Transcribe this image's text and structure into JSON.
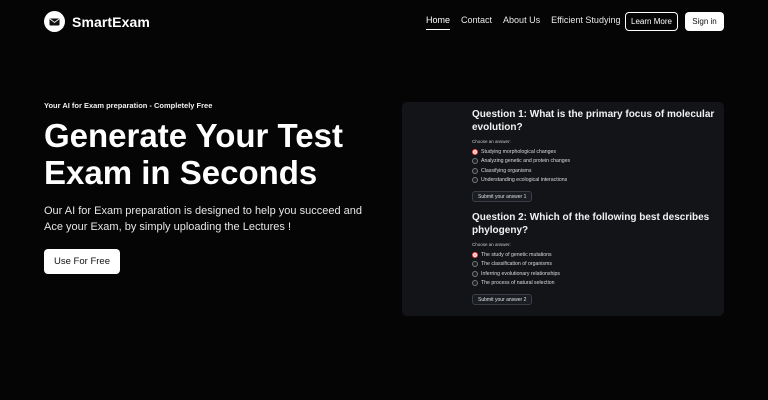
{
  "header": {
    "logo_text": "SmartExam",
    "nav": [
      "Home",
      "Contact",
      "About Us",
      "Efficient Studying"
    ],
    "active_nav": "Home",
    "learn_more": "Learn More",
    "sign_in": "Sign in"
  },
  "hero": {
    "tagline": "Your AI for Exam preparation - Completely Free",
    "headline": "Generate Your Test Exam in Seconds",
    "description": "Our AI for Exam preparation is designed to help you succeed and Ace your Exam, by simply uploading the Lectures !",
    "cta": "Use For Free"
  },
  "quiz": {
    "questions": [
      {
        "title": "Question 1: What is the primary focus of molecular evolution?",
        "choose": "Choose an answer:",
        "options": [
          "Studying morphological changes",
          "Analyzing genetic and protein changes",
          "Classifying organisms",
          "Understanding ecological interactions"
        ],
        "selected": 0,
        "submit": "Submit your answer 1"
      },
      {
        "title": "Question 2: Which of the following best describes phylogeny?",
        "choose": "Choose an answer:",
        "options": [
          "The study of genetic mutations",
          "The classification of organisms",
          "Inferring evolutionary relationships",
          "The process of natural selection"
        ],
        "selected": 0,
        "submit": "Submit your answer 2"
      }
    ]
  },
  "colors": {
    "background": "#050505",
    "panel": "#121418",
    "radio_selected": "#ff4b4b"
  },
  "icons": {
    "logo": "envelope-icon"
  }
}
